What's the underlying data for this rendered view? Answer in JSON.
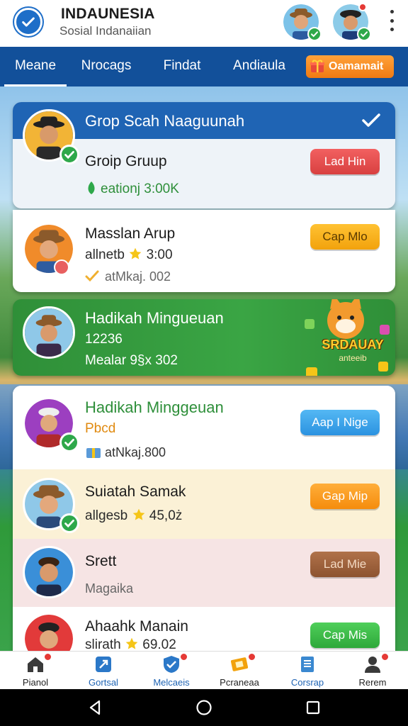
{
  "app": {
    "title": "INDAUNESIA",
    "subtitle": "Sosial Indanaiian"
  },
  "tabs": [
    {
      "label": "Meane",
      "active": true
    },
    {
      "label": "Nrocags",
      "active": false
    },
    {
      "label": "Findat",
      "active": false
    },
    {
      "label": "Andiaula",
      "active": false
    }
  ],
  "promo_tab": {
    "label": "Oamamait",
    "icon": "gift-icon"
  },
  "group_card": {
    "title": "Grop Scah Naaguunah",
    "name": "Groip Gruup",
    "stat": "eationj 3:00K",
    "button": "Lad Hin"
  },
  "user_row_1": {
    "name": "Masslan Arup",
    "stat": "allnetb",
    "stat_value": "3:00",
    "sub": "atMkaj. 002",
    "button": "Cap Mlo"
  },
  "featured": {
    "name": "Hadikah Mingueuan",
    "number": "12236",
    "sub": "Mealar 9§x 302",
    "badge_line1": "SRDAUAY",
    "badge_line2": "anteeib"
  },
  "list": [
    {
      "name": "Hadikah Minggeuan",
      "line2": "Pbcd",
      "line3": "atNkaj.800",
      "button": "Aap I Nige",
      "color": "blue"
    },
    {
      "name": "Suiatah Samak",
      "line2": "allgesb",
      "line2_value": "45,0ż",
      "button": "Gap Mip",
      "color": "orange"
    },
    {
      "name": "Srett",
      "line2": "Magaika",
      "button": "Lad Mie",
      "color": "brown"
    },
    {
      "name": "Ahaahk Manain",
      "line2": "slirath",
      "line2_value": "69.02",
      "button": "Cap Mis",
      "color": "green"
    }
  ],
  "bottom_nav": [
    {
      "label": "Pianol",
      "icon": "home-icon"
    },
    {
      "label": "Gortsal",
      "icon": "share-icon"
    },
    {
      "label": "Melcaeis",
      "icon": "shield-check-icon"
    },
    {
      "label": "Pcraneaa",
      "icon": "ticket-icon"
    },
    {
      "label": "Corsrap",
      "icon": "book-icon"
    },
    {
      "label": "Rerem",
      "icon": "profile-icon"
    }
  ],
  "colors": {
    "brand_blue": "#12509a",
    "accent_green": "#2ea84a",
    "featured_green": "#2f8f38"
  }
}
